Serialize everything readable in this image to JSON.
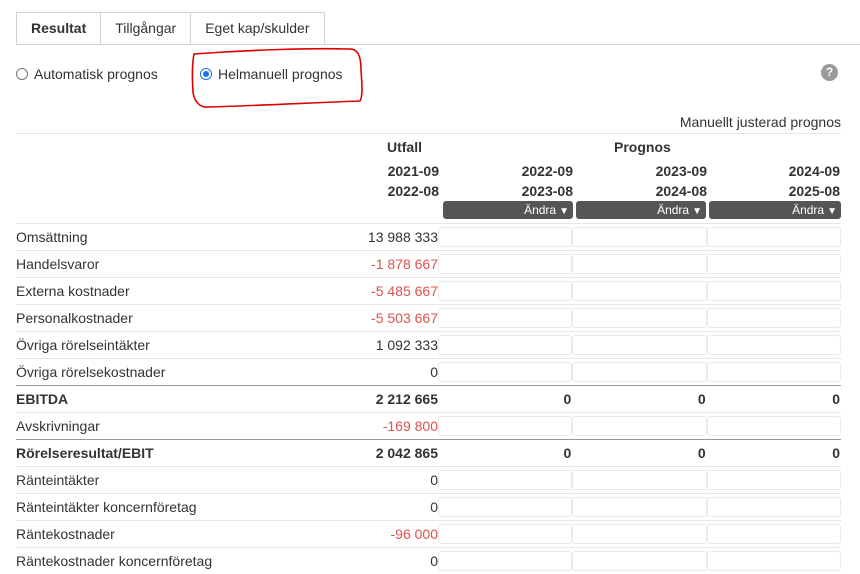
{
  "tabs": [
    "Resultat",
    "Tillgångar",
    "Eget kap/skulder"
  ],
  "radios": {
    "auto": "Automatisk prognos",
    "manual": "Helmanuell prognos"
  },
  "help": "?",
  "manual_label": "Manuellt justerad prognos",
  "headers": {
    "actual": "Utfall",
    "forecast": "Prognos"
  },
  "periods": [
    {
      "from": "2021-09",
      "to": "2022-08"
    },
    {
      "from": "2022-09",
      "to": "2023-08"
    },
    {
      "from": "2023-09",
      "to": "2024-08"
    },
    {
      "from": "2024-09",
      "to": "2025-08"
    }
  ],
  "change_label": "Ändra",
  "rows": [
    {
      "label": "Omsättning",
      "value": "13 988 333"
    },
    {
      "label": "Handelsvaror",
      "value": "-1 878 667"
    },
    {
      "label": "Externa kostnader",
      "value": "-5 485 667"
    },
    {
      "label": "Personalkostnader",
      "value": "-5 503 667"
    },
    {
      "label": "Övriga rörelseintäkter",
      "value": "1 092 333"
    },
    {
      "label": "Övriga rörelsekostnader",
      "value": "0"
    },
    {
      "label": "EBITDA",
      "value": "2 212 665",
      "f1": "0",
      "f2": "0",
      "f3": "0"
    },
    {
      "label": "Avskrivningar",
      "value": "-169 800"
    },
    {
      "label": "Rörelseresultat/EBIT",
      "value": "2 042 865",
      "f1": "0",
      "f2": "0",
      "f3": "0"
    },
    {
      "label": "Ränteintäkter",
      "value": "0"
    },
    {
      "label": "Ränteintäkter koncernföretag",
      "value": "0"
    },
    {
      "label": "Räntekostnader",
      "value": "-96 000"
    },
    {
      "label": "Räntekostnader koncernföretag",
      "value": "0"
    }
  ]
}
